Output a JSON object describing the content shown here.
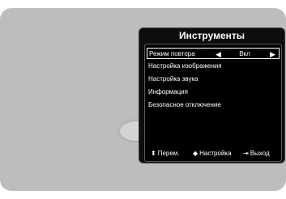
{
  "osd": {
    "title": "Инструменты",
    "items": [
      {
        "label": "Режим повтора",
        "value": "Вкл"
      },
      {
        "label": "Настройка изображения"
      },
      {
        "label": "Настройка звука"
      },
      {
        "label": "Информация"
      },
      {
        "label": "Безопасное отключение"
      }
    ],
    "footer": {
      "move_label": "Перем.",
      "adjust_label": "Настройка",
      "exit_label": "Выход"
    }
  }
}
